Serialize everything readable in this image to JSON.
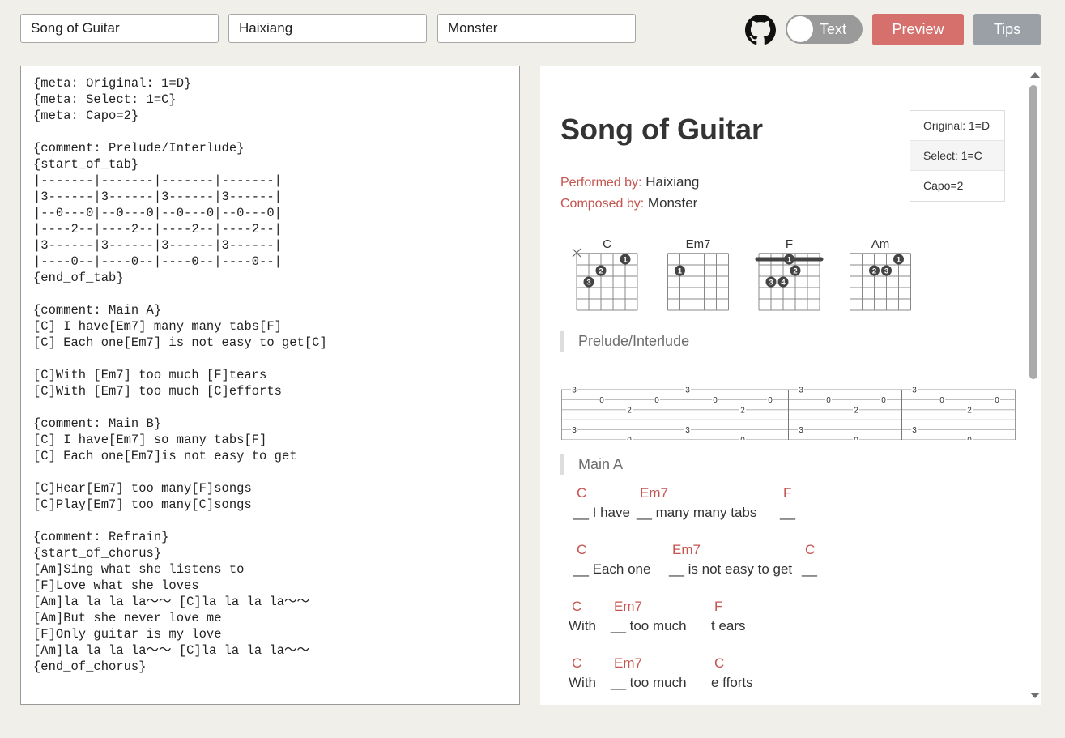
{
  "toolbar": {
    "title_value": "Song of Guitar",
    "performer_value": "Haixiang",
    "composer_value": "Monster",
    "toggle_label": "Text",
    "preview_label": "Preview",
    "tips_label": "Tips"
  },
  "editor": {
    "source": "{meta: Original: 1=D}\n{meta: Select: 1=C}\n{meta: Capo=2}\n\n{comment: Prelude/Interlude}\n{start_of_tab}\n|-------|-------|-------|-------|\n|3------|3------|3------|3------|\n|--0---0|--0---0|--0---0|--0---0|\n|----2--|----2--|----2--|----2--|\n|3------|3------|3------|3------|\n|----0--|----0--|----0--|----0--|\n{end_of_tab}\n\n{comment: Main A}\n[C] I have[Em7] many many tabs[F]\n[C] Each one[Em7] is not easy to get[C]\n\n[C]With [Em7] too much [F]tears\n[C]With [Em7] too much [C]efforts\n\n{comment: Main B}\n[C] I have[Em7] so many tabs[F]\n[C] Each one[Em7]is not easy to get\n\n[C]Hear[Em7] too many[F]songs\n[C]Play[Em7] too many[C]songs\n\n{comment: Refrain}\n{start_of_chorus}\n[Am]Sing what she listens to\n[F]Love what she loves\n[Am]la la la la～～ [C]la la la la～～\n[Am]But she never love me\n[F]Only guitar is my love\n[Am]la la la la～～ [C]la la la la～～\n{end_of_chorus}"
  },
  "preview": {
    "title": "Song of Guitar",
    "performed_label": "Performed by:",
    "performer": "Haixiang",
    "composed_label": "Composed by:",
    "composer": "Monster",
    "meta_items": [
      "Original: 1=D",
      "Select: 1=C",
      "Capo=2"
    ],
    "chords": [
      {
        "name": "C",
        "muted": [
          6
        ],
        "barre": null,
        "dots": [
          {
            "s": 2,
            "f": 1,
            "n": "1"
          },
          {
            "s": 4,
            "f": 2,
            "n": "2"
          },
          {
            "s": 5,
            "f": 3,
            "n": "3"
          }
        ]
      },
      {
        "name": "Em7",
        "muted": [],
        "barre": null,
        "dots": [
          {
            "s": 5,
            "f": 2,
            "n": "1"
          }
        ]
      },
      {
        "name": "F",
        "muted": [],
        "barre": {
          "fret": 1,
          "n": "1"
        },
        "dots": [
          {
            "s": 3,
            "f": 2,
            "n": "2"
          },
          {
            "s": 5,
            "f": 3,
            "n": "3"
          },
          {
            "s": 4,
            "f": 3,
            "n": "4"
          }
        ]
      },
      {
        "name": "Am",
        "muted": [],
        "barre": null,
        "dots": [
          {
            "s": 2,
            "f": 1,
            "n": "1"
          },
          {
            "s": 4,
            "f": 2,
            "n": "2"
          },
          {
            "s": 3,
            "f": 2,
            "n": "3"
          }
        ]
      }
    ],
    "sections": {
      "prelude": "Prelude/Interlude",
      "main_a": "Main A"
    },
    "tab": [
      [
        {
          "s": 1,
          "v": "3"
        },
        {
          "s": 2,
          "v": "0"
        },
        {
          "s": 3,
          "v": "2"
        },
        {
          "s": 2,
          "v": "0"
        }
      ],
      [
        {
          "s": 1,
          "v": "3"
        },
        {
          "s": 2,
          "v": "0"
        },
        {
          "s": 3,
          "v": "2"
        },
        {
          "s": 2,
          "v": "0"
        }
      ],
      [
        {
          "s": 1,
          "v": "3"
        },
        {
          "s": 2,
          "v": "0"
        },
        {
          "s": 3,
          "v": "2"
        },
        {
          "s": 2,
          "v": "0"
        }
      ],
      [
        {
          "s": 1,
          "v": "3"
        },
        {
          "s": 2,
          "v": "0"
        },
        {
          "s": 3,
          "v": "2"
        },
        {
          "s": 2,
          "v": "0"
        }
      ]
    ],
    "tab_bass": [
      [
        {
          "s": 5,
          "v": "3"
        },
        {
          "s": 6,
          "v": "0"
        }
      ],
      [
        {
          "s": 5,
          "v": "3"
        },
        {
          "s": 6,
          "v": "0"
        }
      ],
      [
        {
          "s": 5,
          "v": "3"
        },
        {
          "s": 6,
          "v": "0"
        }
      ],
      [
        {
          "s": 5,
          "v": "3"
        },
        {
          "s": 6,
          "v": "0"
        }
      ]
    ],
    "lyrics": [
      [
        {
          "chord": "C",
          "text": "__ I have"
        },
        {
          "chord": "Em7",
          "text": "__ many many tabs"
        },
        {
          "chord": "F",
          "text": "__"
        }
      ],
      [
        {
          "chord": "C",
          "text": "__ Each one"
        },
        {
          "chord": "Em7",
          "text": "__ is not easy to get"
        },
        {
          "chord": "C",
          "text": "__"
        }
      ],
      [
        {
          "chord": "C",
          "text": "With"
        },
        {
          "chord": "Em7",
          "text": "__ too much"
        },
        {
          "chord": "F",
          "text": "t ears"
        }
      ],
      [
        {
          "chord": "C",
          "text": "With"
        },
        {
          "chord": "Em7",
          "text": "__ too much"
        },
        {
          "chord": "C",
          "text": "e fforts"
        }
      ]
    ]
  }
}
